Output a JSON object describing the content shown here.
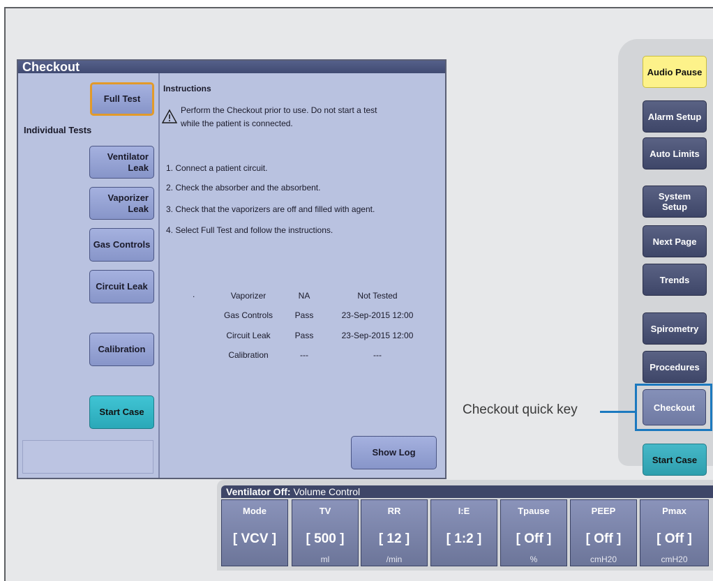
{
  "checkout": {
    "title": "Checkout",
    "full_test": "Full Test",
    "individual_tests_label": "Individual Tests",
    "tests": [
      "Ventilator\nLeak",
      "Vaporizer\nLeak",
      "Gas Controls",
      "Circuit Leak",
      "Calibration"
    ],
    "start_case": "Start Case",
    "instructions_title": "Instructions",
    "warning_line1": "Perform the Checkout prior to use. Do not start a test",
    "warning_line2": "while the patient is connected.",
    "steps": [
      "1.  Connect a patient circuit.",
      "2.  Check the absorber and the absorbent.",
      "3.  Check that the vaporizers are off and filled with agent.",
      "4.  Select Full Test and follow the instructions."
    ],
    "results_dot": ".",
    "results": [
      {
        "name": "Vaporizer",
        "status": "NA",
        "time": "Not Tested"
      },
      {
        "name": "Gas Controls",
        "status": "Pass",
        "time": "23-Sep-2015 12:00"
      },
      {
        "name": "Circuit Leak",
        "status": "Pass",
        "time": "23-Sep-2015  12:00"
      },
      {
        "name": "Calibration",
        "status": "---",
        "time": "---"
      }
    ],
    "show_log": "Show Log",
    "warning_icon": "warning-triangle-icon"
  },
  "quick_keys": [
    "Audio Pause",
    "Alarm Setup",
    "Auto Limits",
    "System\nSetup",
    "Next Page",
    "Trends",
    "Spirometry",
    "Procedures",
    "Checkout",
    "Start Case"
  ],
  "callout": "Checkout quick key",
  "ventilator": {
    "status_label": "Ventilator Off:",
    "mode_label": " Volume Control",
    "params": [
      {
        "name": "Mode",
        "value": "[ VCV ]",
        "unit": ""
      },
      {
        "name": "TV",
        "value": "[ 500 ]",
        "unit": "ml"
      },
      {
        "name": "RR",
        "value": "[ 12 ]",
        "unit": "/min"
      },
      {
        "name": "I:E",
        "value": "[ 1:2 ]",
        "unit": ""
      },
      {
        "name": "Tpause",
        "value": "[ Off ]",
        "unit": "%"
      },
      {
        "name": "PEEP",
        "value": "[ Off ]",
        "unit": "cmH20"
      },
      {
        "name": "Pmax",
        "value": "[ Off ]",
        "unit": "cmH20"
      }
    ]
  },
  "colors": {
    "window_bg": "#b9c2e0",
    "title_bar": "#404a72",
    "audio_pause": "#fdf28a",
    "start_case": "#2aa8b8",
    "highlight": "#1b79bf",
    "full_test_border": "#e29a2a"
  }
}
